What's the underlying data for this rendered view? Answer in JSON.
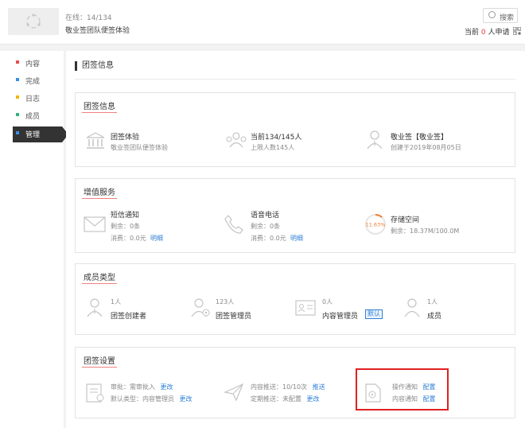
{
  "header": {
    "online_label": "在线：14/134",
    "group_name": "敬业签团队便签体验",
    "search_label": "搜索",
    "applicants_prefix": "当前",
    "applicants_count": "0",
    "applicants_suffix": "人申请"
  },
  "sidebar": {
    "items": [
      {
        "label": "内容",
        "color": "#e84a4a"
      },
      {
        "label": "完成",
        "color": "#3a8ee6"
      },
      {
        "label": "日志",
        "color": "#f0b400"
      },
      {
        "label": "成员",
        "color": "#2fb37a"
      },
      {
        "label": "管理",
        "color": "#3a8ee6",
        "active": true
      }
    ]
  },
  "page_title": "团签信息",
  "info_card": {
    "title": "团签信息",
    "items": [
      {
        "main": "团签体验",
        "sub": "敬业签团队便签体验"
      },
      {
        "main": "当前134/145人",
        "sub": "上限人数145人"
      },
      {
        "main": "敬业签【敬业签】",
        "sub": "创建于2019年08月05日"
      }
    ]
  },
  "vas_card": {
    "title": "增值服务",
    "sms": {
      "title": "短信通知",
      "remain": "剩余：0条",
      "spent": "消费：0.0元",
      "link": "明细"
    },
    "voice": {
      "title": "语音电话",
      "remain": "剩余：0条",
      "spent": "消费：0.0元",
      "link": "明细"
    },
    "storage": {
      "title": "存储空间",
      "percent_label": "11.63%",
      "percent": 11.63,
      "remain": "剩余：18.37M/100.0M"
    }
  },
  "member_card": {
    "title": "成员类型",
    "items": [
      {
        "count": "1人",
        "label": "团签创建者"
      },
      {
        "count": "123人",
        "label": "团签管理员"
      },
      {
        "count": "0人",
        "label": "内容管理员",
        "tag": "默认"
      },
      {
        "count": "1人",
        "label": "成员"
      }
    ]
  },
  "settings_card": {
    "title": "团签设置",
    "audit": {
      "line1": "审批：需审批入",
      "link1": "更改",
      "line2": "默认类型：内容管理员",
      "link2": "更改"
    },
    "push": {
      "line1": "内容推送：10/10次",
      "link1": "推送",
      "line2": "定期推送：未配置",
      "link2": "更改"
    },
    "notify": {
      "line1": "操作通知",
      "link1": "配置",
      "line2": "内容通知",
      "link2": "配置"
    }
  }
}
